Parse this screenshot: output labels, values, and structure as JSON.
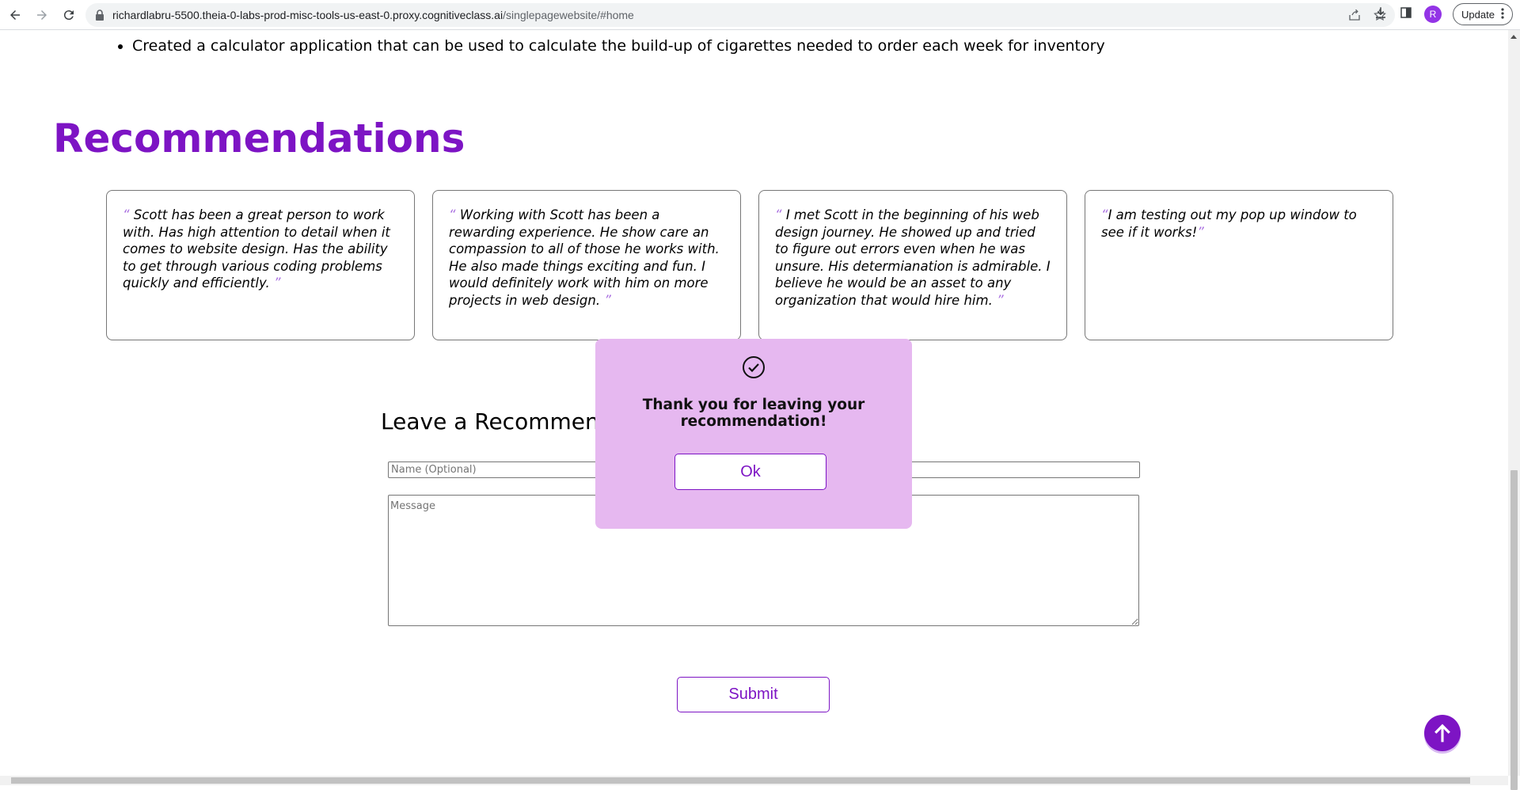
{
  "browser": {
    "url_host": "richardlabru-5500.theia-0-labs-prod-misc-tools-us-east-0.proxy.cognitiveclass.ai",
    "url_path": "/singlepagewebsite/#home",
    "avatar_letter": "R",
    "update_label": "Update"
  },
  "page": {
    "bullets": [
      "Created a calculator application that can be used to calculate the build-up of cigarettes needed to order each week for inventory"
    ],
    "recommendations_title": "Recommendations",
    "recommendations": [
      {
        "open_quote": "“",
        "text": "Scott has been a great person to work with. Has high attention to detail when it comes to website design. Has the ability to get through various coding problems quickly and efficiently.",
        "close_quote": "”"
      },
      {
        "open_quote": "“",
        "text": "Working with Scott has been a rewarding experience. He show care an compassion to all of those he works with. He also made things exciting and fun. I would definitely work with him on more projects in web design.",
        "close_quote": "”"
      },
      {
        "open_quote": "“",
        "text": "I met Scott in the beginning of his web design journey. He showed up and tried to figure out errors even when he was unsure. His determianation is admirable. I believe he would be an asset to any organization that would hire him.",
        "close_quote": "”"
      },
      {
        "open_quote": "“",
        "text": "I am testing out my pop up window to see if it works!",
        "close_quote": "”"
      }
    ],
    "form": {
      "title": "Leave a Recommendation",
      "name_placeholder": "Name (Optional)",
      "message_placeholder": "Message",
      "submit_label": "Submit"
    }
  },
  "popup": {
    "message": "Thank you for leaving your recommendation!",
    "ok_label": "Ok"
  },
  "colors": {
    "accent": "#7d14c4",
    "popup_bg": "#e6b8f0"
  }
}
